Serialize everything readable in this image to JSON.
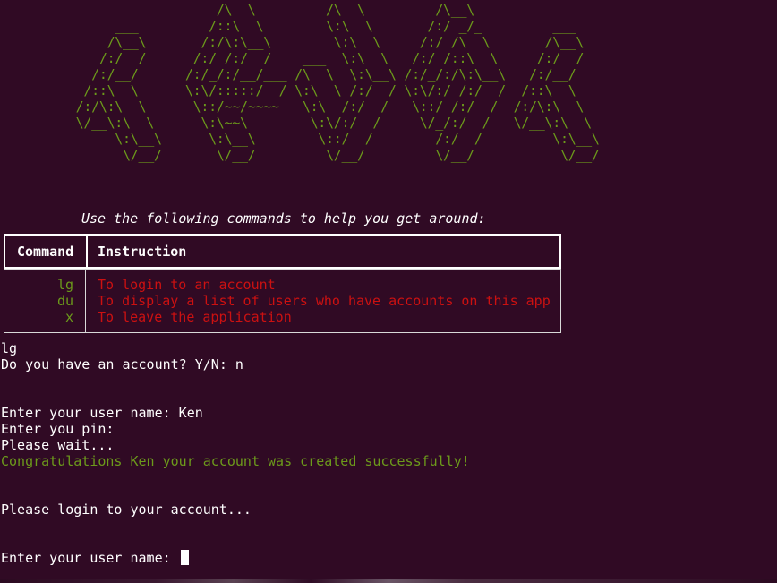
{
  "banner_art": "                       /\\  \\         /\\  \\         /\\__\\\n          ___         /::\\  \\        \\:\\  \\       /:/ _/_         ___\n         /\\__\\       /:/\\:\\__\\        \\:\\  \\     /:/ /\\  \\       /\\__\\\n        /:/  /      /:/ /:/  /    ___  \\:\\  \\   /:/ /::\\  \\     /:/  /\n       /:/__/      /:/_/:/__/___ /\\  \\  \\:\\__\\ /:/_/:/\\:\\__\\   /:/__/\n      /::\\  \\      \\:\\/:::::/  / \\:\\  \\ /:/  / \\:\\/:/ /:/  /  /::\\  \\\n     /:/\\:\\  \\      \\::/~~/~~~~   \\:\\  /:/  /   \\::/ /:/  /  /:/\\:\\  \\\n     \\/__\\:\\  \\      \\:\\~~\\        \\:\\/:/  /     \\/_/:/  /   \\/__\\:\\  \\\n          \\:\\__\\      \\:\\__\\        \\::/  /        /:/  /         \\:\\__\\\n           \\/__/       \\/__/         \\/__/         \\/__/           \\/__/",
  "subtitle": "Use the following commands to help you get around:",
  "table": {
    "headers": {
      "command": "Command",
      "instruction": "Instruction"
    },
    "rows": [
      {
        "key": "lg",
        "desc": "To login to an account"
      },
      {
        "key": "du",
        "desc": "To display a list of users who have accounts on this app"
      },
      {
        "key": "x",
        "desc": "To leave the application"
      }
    ]
  },
  "session": {
    "line1": "lg",
    "line2": "Do you have an account? Y/N: n",
    "line3": "Enter your user name: Ken",
    "line4": "Enter you pin:",
    "line5": "Please wait...",
    "line6": "Congratulations Ken your account was created successfully!",
    "line7": "Please login to your account...",
    "line8": "Enter your user name: "
  },
  "colors": {
    "background": "#300a24",
    "banner": "#6c9a1b",
    "command_keys": "#6c9a1b",
    "instructions": "#cc1111",
    "success": "#6c9a1b",
    "text": "#ffffff"
  }
}
